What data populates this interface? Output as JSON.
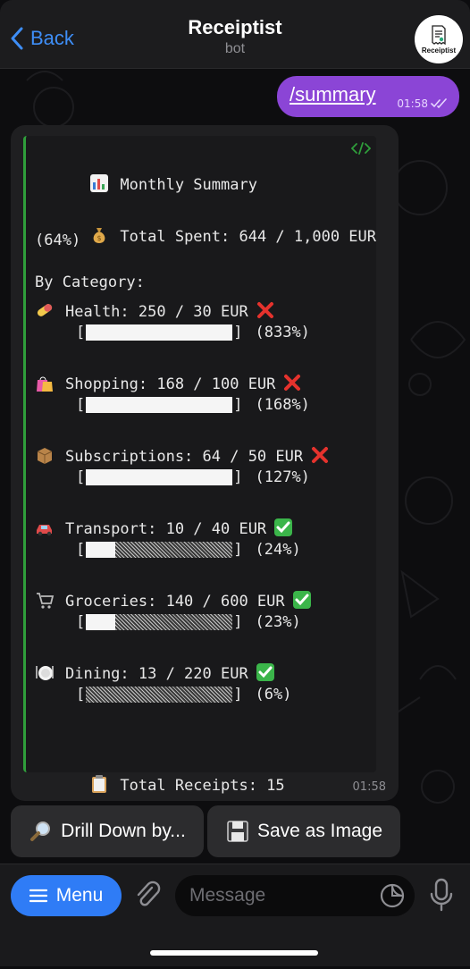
{
  "header": {
    "back_label": "Back",
    "title": "Receiptist",
    "subtitle": "bot",
    "avatar_text": "Receiptist"
  },
  "outgoing": {
    "text": "/summary",
    "time": "01:58"
  },
  "summary": {
    "title_line": "Monthly Summary",
    "total_line_1": "Total Spent: 644 / 1,000 EUR",
    "total_line_2": "(64%)",
    "by_category": "By Category:",
    "categories": [
      {
        "label": "Health: 250 / 30 EUR",
        "pct": "(833%)",
        "fill": 1.0,
        "over": true,
        "emoji": "pill-emoji"
      },
      {
        "label": "Shopping: 168 / 100 EUR",
        "pct": "(168%)",
        "fill": 1.0,
        "over": true,
        "emoji": "shopping-bags-emoji"
      },
      {
        "label": "Subscriptions: 64 / 50 EUR",
        "pct": "(127%)",
        "fill": 1.0,
        "over": true,
        "emoji": "package-emoji"
      },
      {
        "label": "Transport: 10 / 40 EUR",
        "pct": "(24%)",
        "fill": 0.2,
        "over": false,
        "emoji": "car-emoji"
      },
      {
        "label": "Groceries: 140 / 600 EUR",
        "pct": "(23%)",
        "fill": 0.2,
        "over": false,
        "emoji": "shopping-cart-emoji"
      },
      {
        "label": "Dining: 13 / 220 EUR",
        "pct": "(6%)",
        "fill": 0.0,
        "over": false,
        "emoji": "plate-emoji"
      }
    ],
    "receipts_line": "Total Receipts: 15",
    "time": "01:58"
  },
  "buttons": {
    "drill_down": "Drill Down by...",
    "save_image": "Save as Image"
  },
  "composer": {
    "menu_label": "Menu",
    "placeholder": "Message"
  },
  "colors": {
    "accent_blue": "#3e8ef7",
    "outgoing_bubble": "#8b45d6",
    "code_border": "#2f9e3b",
    "menu_button": "#2f7cf6"
  }
}
